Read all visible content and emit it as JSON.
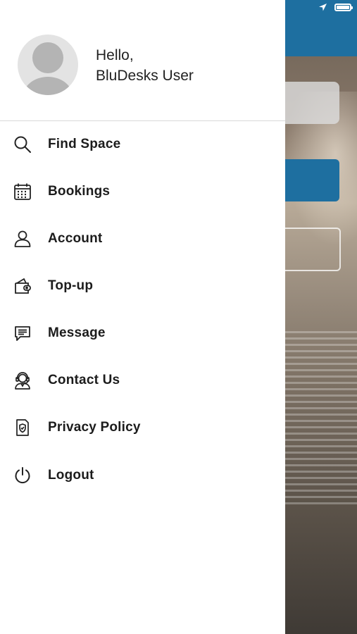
{
  "profile": {
    "greeting_line1": "Hello,",
    "greeting_line2": "BluDesks User"
  },
  "menu": {
    "items": [
      {
        "label": "Find Space",
        "icon": "search-icon"
      },
      {
        "label": "Bookings",
        "icon": "calendar-icon"
      },
      {
        "label": "Account",
        "icon": "user-icon"
      },
      {
        "label": "Top-up",
        "icon": "wallet-icon"
      },
      {
        "label": "Message",
        "icon": "message-icon"
      },
      {
        "label": "Contact Us",
        "icon": "headset-icon"
      },
      {
        "label": "Privacy Policy",
        "icon": "shield-document-icon"
      },
      {
        "label": "Logout",
        "icon": "power-icon"
      }
    ]
  },
  "colors": {
    "accent": "#1e6fa0",
    "text": "#1c1c1c",
    "divider": "#d8d8d8"
  }
}
